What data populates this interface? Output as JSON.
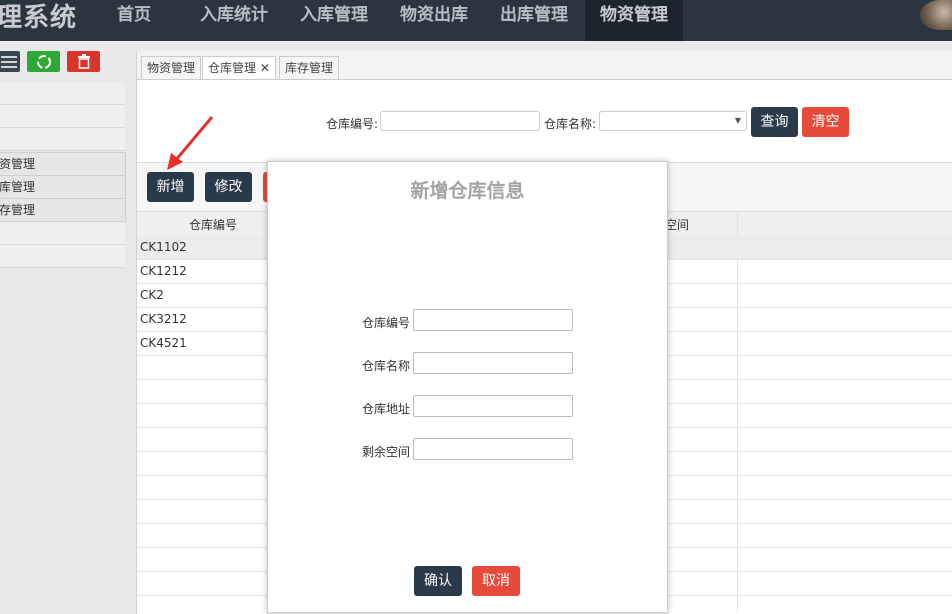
{
  "brand": "理系统",
  "nav": [
    {
      "label": "首页",
      "active": false
    },
    {
      "label": "入库统计",
      "active": false
    },
    {
      "label": "入库管理",
      "active": false
    },
    {
      "label": "物资出库",
      "active": false
    },
    {
      "label": "出库管理",
      "active": false
    },
    {
      "label": "物资管理",
      "active": true
    }
  ],
  "sidebar": {
    "items": [
      "资管理",
      "库管理",
      "存管理"
    ],
    "icons": [
      "menu-icon",
      "recycle-icon",
      "trash-icon"
    ]
  },
  "tabs": [
    {
      "label": "物资管理",
      "active": false
    },
    {
      "label": "仓库管理 ✕",
      "active": true
    },
    {
      "label": "库存管理",
      "active": false
    }
  ],
  "search": {
    "code_label": "仓库编号:",
    "name_label": "仓库名称:",
    "name_value": "",
    "query_button": "查询",
    "clear_button": "清空"
  },
  "toolbar": {
    "add_button": "新增",
    "edit_button": "修改"
  },
  "grid": {
    "headers": [
      "仓库编号",
      "空间"
    ],
    "rows": [
      "CK1102",
      "CK1212",
      "CK2",
      "CK3212",
      "CK4521"
    ]
  },
  "modal": {
    "title": "新增仓库信息",
    "fields": [
      {
        "label": "仓库编号",
        "value": ""
      },
      {
        "label": "仓库名称",
        "value": ""
      },
      {
        "label": "仓库地址",
        "value": ""
      },
      {
        "label": "剩余空间",
        "value": ""
      }
    ],
    "confirm_button": "确认",
    "cancel_button": "取消"
  },
  "colors": {
    "topbar": "#2b3540",
    "primary_button": "#2b3a4a",
    "danger_button": "#e64a3a",
    "annotation_arrow": "#e8302a"
  }
}
